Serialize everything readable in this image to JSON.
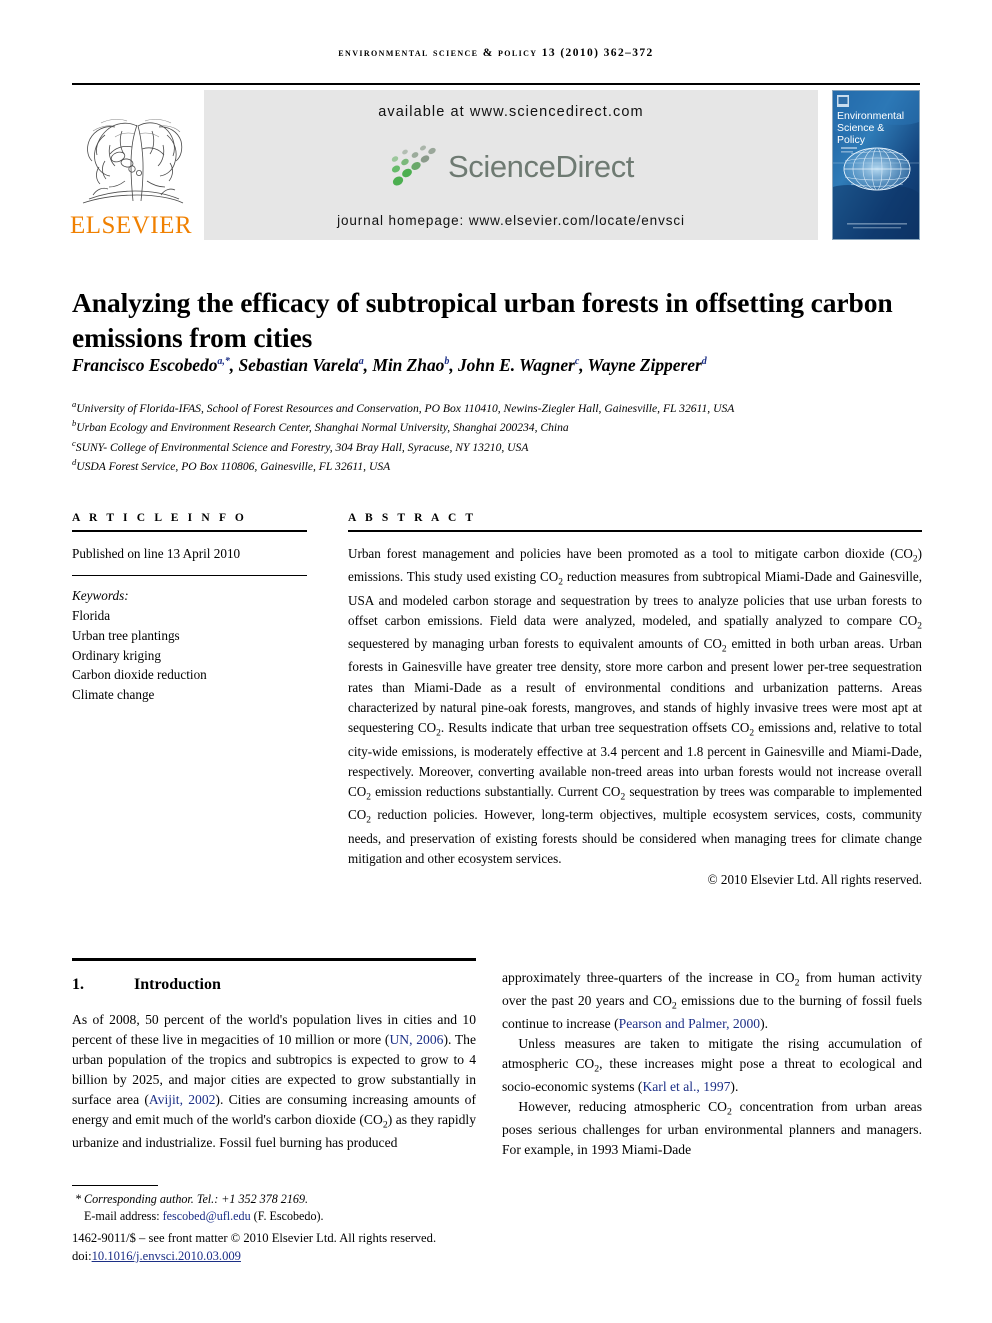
{
  "running_head": "Environmental Science & Policy 13 (2010) 362–372",
  "masthead": {
    "publisher_name": "ELSEVIER",
    "available_at": "available at www.sciencedirect.com",
    "sciencedirect_word": "ScienceDirect",
    "journal_homepage": "journal homepage: www.elsevier.com/locate/envsci",
    "cover": {
      "line1": "Environmental",
      "line2": "Science &",
      "line3": "Policy"
    },
    "colors": {
      "elsevier_orange": "#f08000",
      "panel_grey": "#e6e6e6",
      "sciencedirect_grey": "#6e7a72",
      "sciencedirect_green": "#4caf50",
      "cover_blue": "#2a6ca8"
    }
  },
  "article": {
    "title": "Analyzing the efficacy of subtropical urban forests in offsetting carbon emissions from cities",
    "authors": [
      {
        "name": "Francisco Escobedo",
        "sup": "a,*"
      },
      {
        "name": "Sebastian Varela",
        "sup": "a"
      },
      {
        "name": "Min Zhao",
        "sup": "b"
      },
      {
        "name": "John E. Wagner",
        "sup": "c"
      },
      {
        "name": "Wayne Zipperer",
        "sup": "d"
      }
    ],
    "affiliations": [
      {
        "marker": "a",
        "text": "University of Florida-IFAS, School of Forest Resources and Conservation, PO Box 110410, Newins-Ziegler Hall, Gainesville, FL 32611, USA"
      },
      {
        "marker": "b",
        "text": "Urban Ecology and Environment Research Center, Shanghai Normal University, Shanghai 200234, China"
      },
      {
        "marker": "c",
        "text": "SUNY- College of Environmental Science and Forestry, 304 Bray Hall, Syracuse, NY 13210, USA"
      },
      {
        "marker": "d",
        "text": "USDA Forest Service, PO Box 110806, Gainesville, FL 32611, USA"
      }
    ]
  },
  "article_info": {
    "heading": "A R T I C L E  I N F O",
    "published": "Published on line 13 April 2010",
    "keywords_label": "Keywords:",
    "keywords": [
      "Florida",
      "Urban tree plantings",
      "Ordinary kriging",
      "Carbon dioxide reduction",
      "Climate change"
    ]
  },
  "abstract": {
    "heading": "A B S T R A C T",
    "paragraphs": [
      "Urban forest management and policies have been promoted as a tool to mitigate carbon dioxide (CO2) emissions. This study used existing CO2 reduction measures from subtropical Miami-Dade and Gainesville, USA and modeled carbon storage and sequestration by trees to analyze policies that use urban forests to offset carbon emissions. Field data were analyzed, modeled, and spatially analyzed to compare CO2 sequestered by managing urban forests to equivalent amounts of CO2 emitted in both urban areas. Urban forests in Gainesville have greater tree density, store more carbon and present lower per-tree sequestration rates than Miami-Dade as a result of environmental conditions and urbanization patterns. Areas characterized by natural pine-oak forests, mangroves, and stands of highly invasive trees were most apt at sequestering CO2. Results indicate that urban tree sequestration offsets CO2 emissions and, relative to total city-wide emissions, is moderately effective at 3.4 percent and 1.8 percent in Gainesville and Miami-Dade, respectively. Moreover, converting available non-treed areas into urban forests would not increase overall CO2 emission reductions substantially. Current CO2 sequestration by trees was comparable to implemented CO2 reduction policies. However, long-term objectives, multiple ecosystem services, costs, community needs, and preservation of existing forests should be considered when managing trees for climate change mitigation and other ecosystem services."
    ],
    "copyright": "© 2010 Elsevier Ltd. All rights reserved."
  },
  "body": {
    "section_number": "1.",
    "section_title": "Introduction",
    "left_paragraphs": [
      "As of 2008, 50 percent of the world's population lives in cities and 10 percent of these live in megacities of 10 million or more (UN, 2006). The urban population of the tropics and subtropics is expected to grow to 4 billion by 2025, and major cities are expected to grow substantially in surface area (Avijit, 2002). Cities are consuming increasing amounts of energy and emit much of the world's carbon dioxide (CO2) as they rapidly urbanize and industrialize. Fossil fuel burning has produced"
    ],
    "right_paragraphs": [
      "approximately three-quarters of the increase in CO2 from human activity over the past 20 years and CO2 emissions due to the burning of fossil fuels continue to increase (Pearson and Palmer, 2000).",
      "Unless measures are taken to mitigate the rising accumulation of atmospheric CO2, these increases might pose a threat to ecological and socio-economic systems (Karl et al., 1997).",
      "However, reducing atmospheric CO2 concentration from urban areas poses serious challenges for urban environmental planners and managers. For example, in 1993 Miami-Dade"
    ],
    "citations": [
      "UN, 2006",
      "Avijit, 2002",
      "Pearson and Palmer, 2000",
      "Karl et al., 1997"
    ]
  },
  "footer": {
    "corresponding_star": "*",
    "corresponding": "Corresponding author. Tel.: +1 352 378 2169.",
    "email_label": "E-mail address:",
    "email": "fescobed@ufl.edu",
    "email_owner": "(F. Escobedo).",
    "issn_line": "1462-9011/$ – see front matter © 2010 Elsevier Ltd. All rights reserved.",
    "doi_label": "doi:",
    "doi": "10.1016/j.envsci.2010.03.009"
  }
}
